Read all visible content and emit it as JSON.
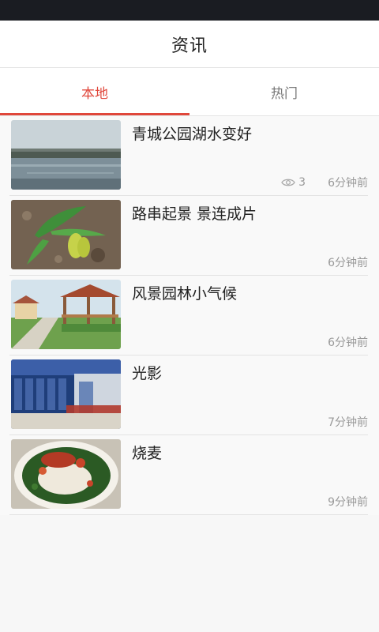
{
  "header": {
    "title": "资讯"
  },
  "tabs": [
    {
      "label": "本地",
      "active": true
    },
    {
      "label": "热门",
      "active": false
    }
  ],
  "news": [
    {
      "title": "青城公园湖水变好",
      "views": "3",
      "time": "6分钟前",
      "image": "lake-scene"
    },
    {
      "title": "路串起景 景连成片",
      "time": "6分钟前",
      "image": "plant-sprout"
    },
    {
      "title": "风景园林小气候",
      "time": "6分钟前",
      "image": "garden-pavilion"
    },
    {
      "title": "光影",
      "time": "7分钟前",
      "image": "glass-building"
    },
    {
      "title": "烧麦",
      "time": "9分钟前",
      "image": "dish"
    }
  ],
  "colors": {
    "accent": "#e0473b",
    "status_bar": "#1a1c22",
    "meta": "#999999"
  }
}
